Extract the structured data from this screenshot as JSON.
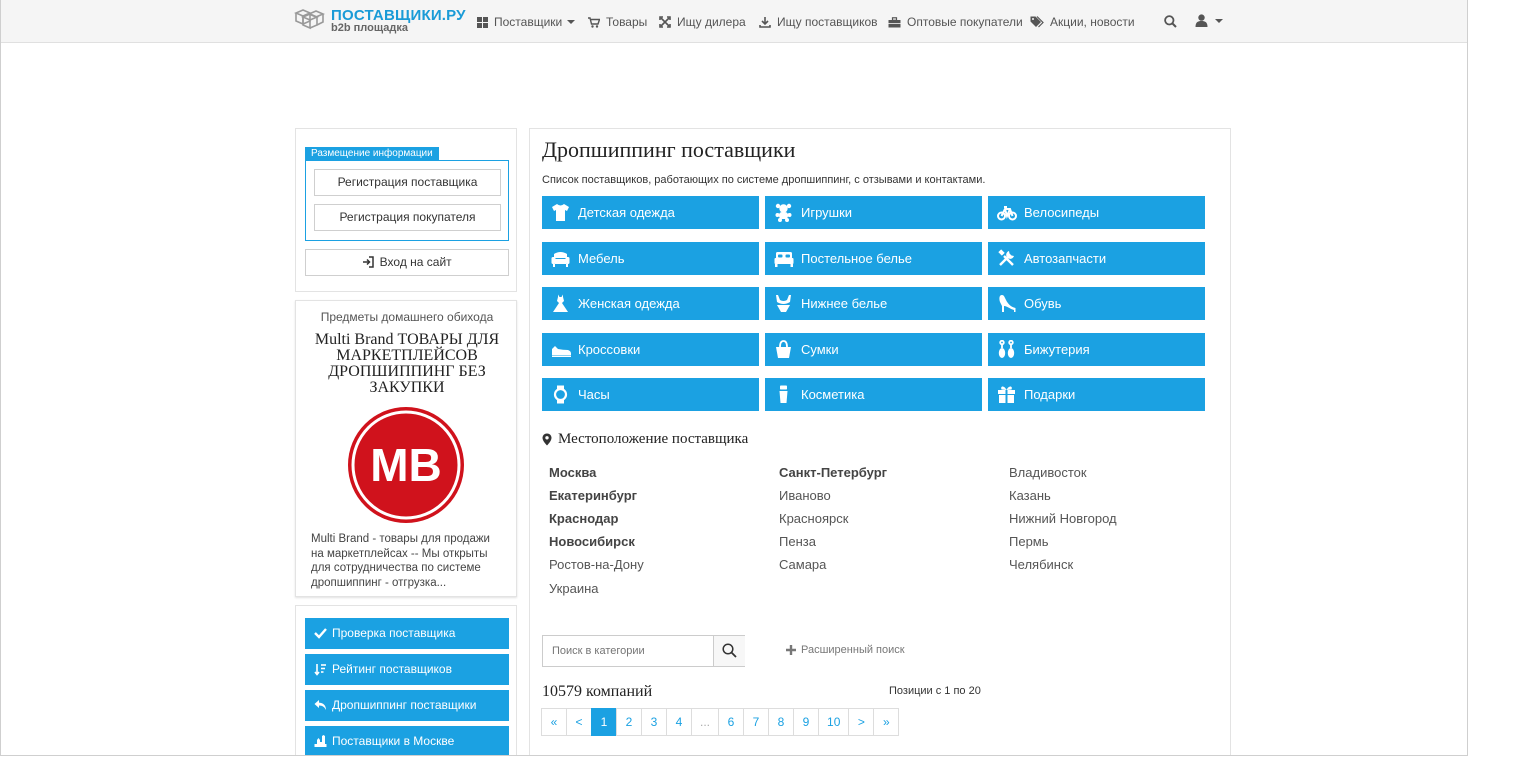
{
  "brand": {
    "title": "ПОСТАВЩИКИ.РУ",
    "subtitle": "b2b площадка",
    "accent_color": "#1ba1e2"
  },
  "nav": {
    "items": [
      {
        "label": "Поставщики",
        "icon": "grid-icon",
        "dropdown": true
      },
      {
        "label": "Товары",
        "icon": "cart-icon"
      },
      {
        "label": "Ищу дилера",
        "icon": "expand-icon"
      },
      {
        "label": "Ищу поставщиков",
        "icon": "download-icon"
      },
      {
        "label": "Оптовые покупатели",
        "icon": "briefcase-icon"
      },
      {
        "label": "Акции, новости",
        "icon": "tags-icon"
      }
    ],
    "search_icon": "search-icon",
    "user_icon": "user-icon"
  },
  "sidebar": {
    "registration": {
      "legend": "Размещение информации",
      "supplier_button": "Регистрация поставщика",
      "buyer_button": "Регистрация покупателя"
    },
    "login_button": "Вход на сайт",
    "ad": {
      "category": "Предметы домашнего обихода",
      "title": "Multi Brand ТОВАРЫ ДЛЯ МАРКЕТПЛЕЙСОВ ДРОПШИППИНГ БЕЗ ЗАКУПКИ",
      "logo_text": "MB",
      "logo_color": "#d0121c",
      "description": "Multi Brand - товары для продажи на маркетплейсах -- Мы открыты для сотрудничества по системе дропшиппинг - отгрузка..."
    },
    "links": [
      {
        "label": "Проверка поставщика",
        "icon": "check-icon"
      },
      {
        "label": "Рейтинг поставщиков",
        "icon": "sort-icon"
      },
      {
        "label": "Дропшиппинг поставщики",
        "icon": "reply-icon"
      },
      {
        "label": "Поставщики в Москве",
        "icon": "city-icon"
      }
    ]
  },
  "main": {
    "title": "Дропшиппинг поставщики",
    "subtitle": "Список поставщиков, работающих по системе дропшиппинг, с отзывами и контактами.",
    "categories": [
      {
        "label": "Детская одежда",
        "icon": "baby-clothes-icon"
      },
      {
        "label": "Игрушки",
        "icon": "toy-icon"
      },
      {
        "label": "Велосипеды",
        "icon": "bicycle-icon"
      },
      {
        "label": "Мебель",
        "icon": "sofa-icon"
      },
      {
        "label": "Постельное белье",
        "icon": "bed-icon"
      },
      {
        "label": "Автозапчасти",
        "icon": "tools-icon"
      },
      {
        "label": "Женская одежда",
        "icon": "dress-icon"
      },
      {
        "label": "Нижнее белье",
        "icon": "underwear-icon"
      },
      {
        "label": "Обувь",
        "icon": "heel-icon"
      },
      {
        "label": "Кроссовки",
        "icon": "sneaker-icon"
      },
      {
        "label": "Сумки",
        "icon": "bag-icon"
      },
      {
        "label": "Бижутерия",
        "icon": "earrings-icon"
      },
      {
        "label": "Часы",
        "icon": "watch-icon"
      },
      {
        "label": "Косметика",
        "icon": "cosmetics-icon"
      },
      {
        "label": "Подарки",
        "icon": "gift-icon"
      }
    ],
    "location_title": "Местоположение поставщика",
    "cities": [
      [
        {
          "name": "Москва",
          "bold": true
        },
        {
          "name": "Екатеринбург",
          "bold": true
        },
        {
          "name": "Краснодар",
          "bold": true
        },
        {
          "name": "Новосибирск",
          "bold": true
        },
        {
          "name": "Ростов-на-Дону",
          "bold": false
        },
        {
          "name": "Украина",
          "bold": false
        }
      ],
      [
        {
          "name": "Санкт-Петербург",
          "bold": true
        },
        {
          "name": "Иваново",
          "bold": false
        },
        {
          "name": "Красноярск",
          "bold": false
        },
        {
          "name": "Пенза",
          "bold": false
        },
        {
          "name": "Самара",
          "bold": false
        }
      ],
      [
        {
          "name": "Владивосток",
          "bold": false
        },
        {
          "name": "Казань",
          "bold": false
        },
        {
          "name": "Нижний Новгород",
          "bold": false
        },
        {
          "name": "Пермь",
          "bold": false
        },
        {
          "name": "Челябинск",
          "bold": false
        }
      ]
    ],
    "search_placeholder": "Поиск в категории",
    "advanced_search": "Расширенный поиск",
    "count": "10579 компаний",
    "positions": "Позиции с 1 по 20",
    "pagination": [
      "«",
      "<",
      "1",
      "2",
      "3",
      "4",
      "...",
      "6",
      "7",
      "8",
      "9",
      "10",
      ">",
      "»"
    ],
    "current_page": "1"
  }
}
